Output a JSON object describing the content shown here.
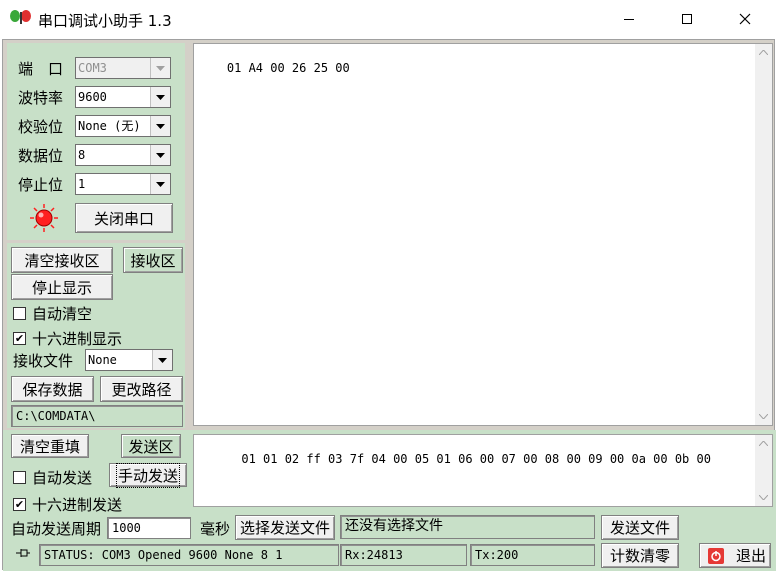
{
  "window": {
    "title": "串口调试小助手 1.3",
    "icon": "butterfly-icon"
  },
  "colors": {
    "panel": "#c8e0c8",
    "led": "#ff2020",
    "exit_icon": "#e53935"
  },
  "port_settings": {
    "port_label": "端　口",
    "port_value": "COM3",
    "baud_label": "波特率",
    "baud_value": "9600",
    "parity_label": "校验位",
    "parity_value": "None (无)",
    "databits_label": "数据位",
    "databits_value": "8",
    "stopbits_label": "停止位",
    "stopbits_value": "1",
    "toggle_port_label": "关闭串口"
  },
  "receive": {
    "clear_label": "清空接收区",
    "area_label": "接收区",
    "stop_display_label": "停止显示",
    "auto_clear_label": "自动清空",
    "auto_clear_checked": false,
    "hex_display_label": "十六进制显示",
    "hex_display_checked": true,
    "file_label": "接收文件",
    "file_format": "None",
    "save_label": "保存数据",
    "change_path_label": "更改路径",
    "path": "C:\\COMDATA\\",
    "content": "01 A4 00 26 25 00"
  },
  "send": {
    "clear_label": "清空重填",
    "area_label": "发送区",
    "auto_send_label": "自动发送",
    "auto_send_checked": false,
    "manual_send_label": "手动发送",
    "hex_send_label": "十六进制发送",
    "hex_send_checked": true,
    "period_label": "自动发送周期",
    "period_value": "1000",
    "ms_label": "毫秒",
    "choose_file_label": "选择发送文件",
    "file_status": "还没有选择文件",
    "send_file_label": "发送文件",
    "content": "01 01 02 ff 03 7f 04 00 05 01 06 00 07 00 08 00 09 00 0a 00 0b 00"
  },
  "statusbar": {
    "status": "STATUS: COM3 Opened 9600 None  8 1",
    "rx": "Rx:24813",
    "tx": "Tx:200",
    "reset_count_label": "计数清零",
    "exit_label": "退出"
  }
}
